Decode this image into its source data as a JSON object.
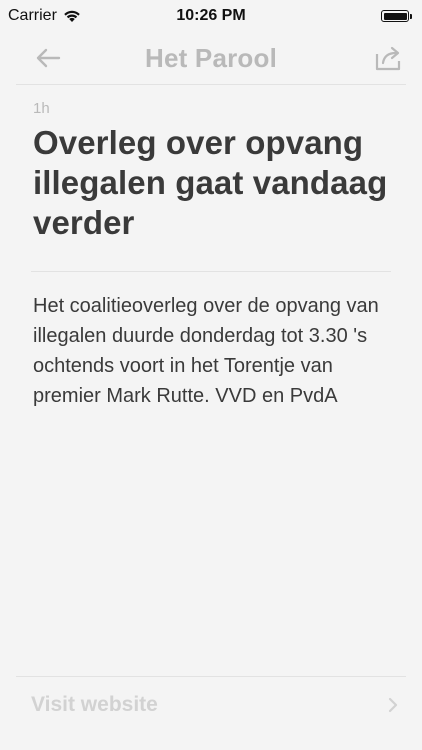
{
  "status_bar": {
    "carrier": "Carrier",
    "time": "10:26 PM",
    "battery_level": 1.0
  },
  "nav": {
    "title": "Het Parool",
    "back_icon": "arrow-left-icon",
    "share_icon": "share-icon"
  },
  "article": {
    "timestamp": "1h",
    "headline": "Overleg over opvang illegalen gaat vandaag verder",
    "body": "Het coalitieoverleg over de opvang van illegalen duurde donderdag tot 3.30 's ochtends voort in het Torentje van premier Mark Rutte. VVD en PvdA"
  },
  "footer": {
    "visit_label": "Visit website",
    "chevron_icon": "chevron-right-icon"
  },
  "colors": {
    "background": "#f4f4f4",
    "text": "#3a3a3a",
    "muted": "#b9b9b9",
    "divider": "#e2e2e2"
  }
}
